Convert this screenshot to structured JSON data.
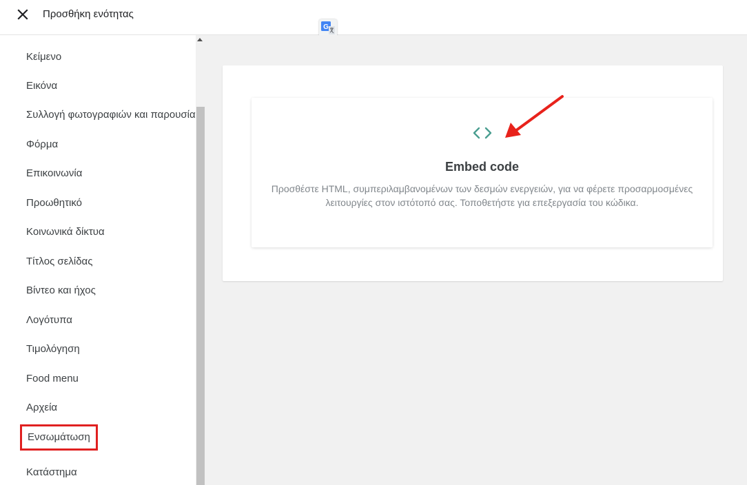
{
  "header": {
    "title": "Προσθήκη ενότητας",
    "close_icon": "close-icon",
    "translate_icon": "google-translate-icon"
  },
  "sidebar": {
    "items": [
      {
        "label": "Κείμενο"
      },
      {
        "label": "Εικόνα"
      },
      {
        "label": "Συλλογή φωτογραφιών και παρουσίαση"
      },
      {
        "label": "Φόρμα"
      },
      {
        "label": "Επικοινωνία"
      },
      {
        "label": "Προωθητικό"
      },
      {
        "label": "Κοινωνικά δίκτυα"
      },
      {
        "label": "Τίτλος σελίδας"
      },
      {
        "label": "Βίντεο και ήχος"
      },
      {
        "label": "Λογότυπα"
      },
      {
        "label": "Τιμολόγηση"
      },
      {
        "label": "Food menu"
      },
      {
        "label": "Αρχεία"
      },
      {
        "label": "Ενσωμάτωση",
        "highlighted": true
      },
      {
        "label": "Κατάστημα"
      }
    ]
  },
  "main": {
    "card": {
      "icon": "code-brackets-icon",
      "title": "Embed code",
      "description": "Προσθέστε HTML, συμπεριλαμβανομένων των δεσμών ενεργειών, για να φέρετε προσαρμοσμένες λειτουργίες στον ιστότοπό σας. Τοποθετήστε για επεξεργασία του κώδικα."
    }
  },
  "colors": {
    "accent_teal": "#4a9e90",
    "highlight_red": "#e02020",
    "arrow_red": "#e8221b"
  }
}
